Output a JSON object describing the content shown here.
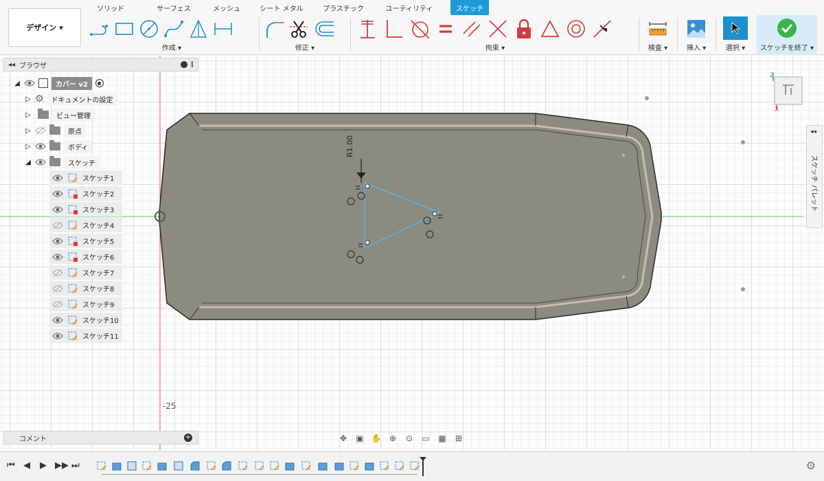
{
  "toolbar": {
    "workspace_label": "デザイン",
    "tabs": [
      {
        "label": "ソリッド"
      },
      {
        "label": "サーフェス"
      },
      {
        "label": "メッシュ"
      },
      {
        "label": "シート メタル"
      },
      {
        "label": "プラスチック"
      },
      {
        "label": "ユーティリティ"
      },
      {
        "label": "スケッチ",
        "active": true
      }
    ],
    "groups": {
      "create": "作成 ▾",
      "modify": "修正 ▾",
      "constraints": "拘束 ▾",
      "inspect": "検査 ▾",
      "insert": "挿入 ▾",
      "select": "選択 ▾",
      "finish": "スケッチを終了 ▾"
    }
  },
  "browser": {
    "title": "ブラウザ",
    "root": "カバー v2",
    "nodes": [
      {
        "label": "ドキュメントの設定"
      },
      {
        "label": "ビュー管理"
      },
      {
        "label": "原点"
      },
      {
        "label": "ボディ"
      },
      {
        "label": "スケッチ"
      }
    ],
    "sketches": [
      "スケッチ1",
      "スケッチ2",
      "スケッチ3",
      "スケッチ4",
      "スケッチ5",
      "スケッチ6",
      "スケッチ7",
      "スケッチ8",
      "スケッチ9",
      "スケッチ10",
      "スケッチ11"
    ]
  },
  "comments": {
    "label": "コメント"
  },
  "canvas": {
    "dimension_label": "R1.00",
    "axis_value": "-25"
  },
  "palette": {
    "label": "スケッチ パレット"
  },
  "viewcube": {
    "top_axis": "Z",
    "side_axis": "X"
  },
  "colors": {
    "accent": "#1d9bd8",
    "finish_green": "#3bb34a",
    "constraint_red": "#d9393c",
    "sketch_blue": "#5ab0e6",
    "body_gray": "#8b8b80"
  }
}
